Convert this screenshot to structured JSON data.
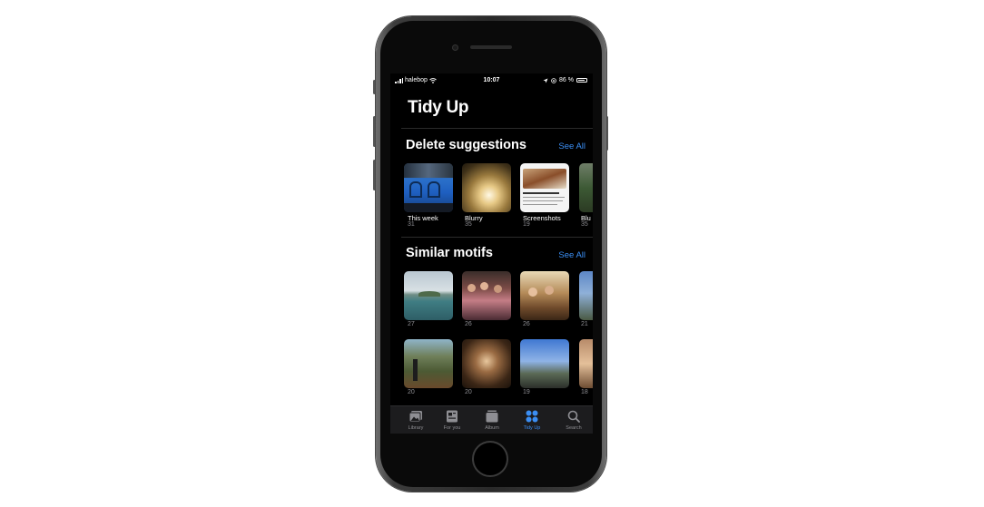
{
  "status_bar": {
    "carrier": "halebop",
    "time": "10:07",
    "battery": "86 %"
  },
  "page_title": "Tidy Up",
  "delete_suggestions": {
    "title": "Delete suggestions",
    "see_all": "See All",
    "items": [
      {
        "label": "This week",
        "count": "31"
      },
      {
        "label": "Blurry",
        "count": "35"
      },
      {
        "label": "Screenshots",
        "count": "19"
      },
      {
        "label": "Blu",
        "count": "35"
      }
    ]
  },
  "similar_motifs": {
    "title": "Similar motifs",
    "see_all": "See All",
    "row1": [
      {
        "count": "27"
      },
      {
        "count": "26"
      },
      {
        "count": "26"
      },
      {
        "count": "21"
      }
    ],
    "row2": [
      {
        "count": "20"
      },
      {
        "count": "20"
      },
      {
        "count": "19"
      },
      {
        "count": "18"
      }
    ]
  },
  "tabs": [
    {
      "label": "Library",
      "icon": "photos-stack-icon"
    },
    {
      "label": "For you",
      "icon": "for-you-icon"
    },
    {
      "label": "Album",
      "icon": "album-icon"
    },
    {
      "label": "Tidy Up",
      "icon": "tidy-up-grid-icon"
    },
    {
      "label": "Search",
      "icon": "search-icon"
    }
  ],
  "colors": {
    "accent": "#3b8ef3",
    "background": "#000000",
    "tabbar": "#1c1c1e",
    "secondary_text": "#8e8e93"
  }
}
